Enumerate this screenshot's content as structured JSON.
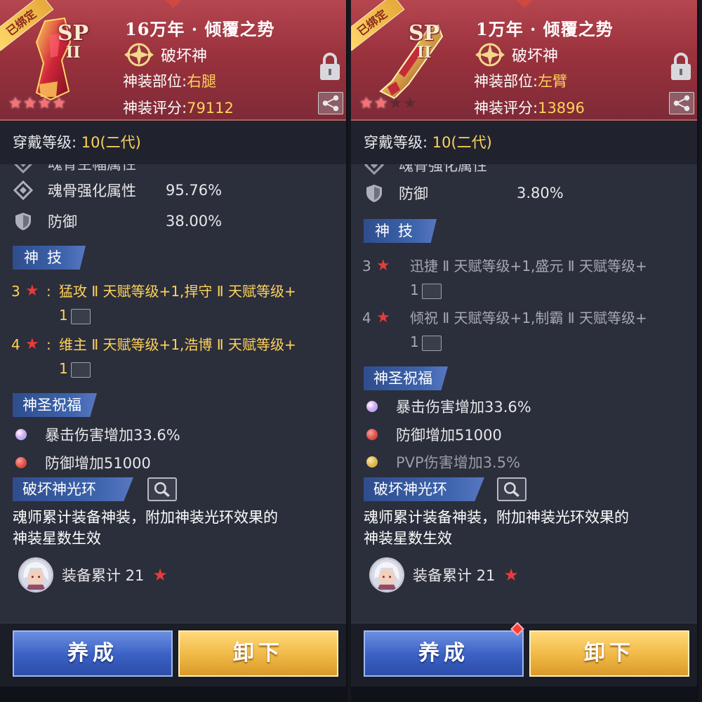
{
  "panels": [
    {
      "bind_tag": "已绑定",
      "sp_label": "SP",
      "sp_rank": "II",
      "title": "16万年 · 倾覆之势",
      "god_name": "破坏神",
      "slot_label": "神装部位:",
      "slot_value": "右腿",
      "score_label": "神装评分:",
      "score_value": "79112",
      "stars_on": 4,
      "stars_total": 4,
      "wear_label": "穿戴等级:",
      "wear_value": "10(二代)",
      "cut_stat": "魂骨主幅属性",
      "stats": [
        {
          "label": "魂骨强化属性",
          "value": "95.76%",
          "icon": "diamond-icon"
        },
        {
          "label": "防御",
          "value": "38.00%",
          "icon": "shield-icon"
        }
      ],
      "skill_tab": "神技",
      "skills": [
        {
          "num": "3",
          "text": "猛攻 Ⅱ 天赋等级+1,捍守 Ⅱ 天赋等级+",
          "text2": "1"
        },
        {
          "num": "4",
          "text": "维主 Ⅱ 天赋等级+1,浩博 Ⅱ 天赋等级+",
          "text2": "1"
        }
      ],
      "bless_tab": "神圣祝福",
      "blessings": [
        {
          "text": "暴击伤害增加33.6%",
          "color": "#d9a8f0"
        },
        {
          "text": "防御增加51000",
          "color": "#d94a43"
        }
      ],
      "aura_tab": "破坏神光环",
      "aura_desc_1": "魂师累计装备神装，附加神装光环效果的",
      "aura_desc_2": "神装星数生效",
      "equip_text": "装备累计 21",
      "btn_train": "养成",
      "btn_unequip": "卸下"
    },
    {
      "bind_tag": "已绑定",
      "sp_label": "SP",
      "sp_rank": "II",
      "title": "1万年 · 倾覆之势",
      "god_name": "破坏神",
      "slot_label": "神装部位:",
      "slot_value": "左臂",
      "score_label": "神装评分:",
      "score_value": "13896",
      "stars_on": 2,
      "stars_total": 4,
      "wear_label": "穿戴等级:",
      "wear_value": "10(二代)",
      "cut_stat": "魂骨强化属性",
      "stats": [
        {
          "label": "防御",
          "value": "3.80%",
          "icon": "shield-icon"
        }
      ],
      "skill_tab": "神技",
      "skills": [
        {
          "num": "3",
          "text": "迅捷 Ⅱ 天赋等级+1,盛元 Ⅱ 天赋等级+",
          "text2": "1"
        },
        {
          "num": "4",
          "text": "倾祝 Ⅱ 天赋等级+1,制霸 Ⅱ 天赋等级+",
          "text2": "1"
        }
      ],
      "bless_tab": "神圣祝福",
      "blessings": [
        {
          "text": "暴击伤害增加33.6%",
          "color": "#d9a8f0"
        },
        {
          "text": "防御增加51000",
          "color": "#d94a43"
        },
        {
          "text": "PVP伤害增加3.5%",
          "color": "#d9b24a"
        }
      ],
      "aura_tab": "破坏神光环",
      "aura_desc_1": "魂师累计装备神装，附加神装光环效果的",
      "aura_desc_2": "神装星数生效",
      "equip_text": "装备累计 21",
      "btn_train": "养成",
      "btn_unequip": "卸下"
    }
  ]
}
